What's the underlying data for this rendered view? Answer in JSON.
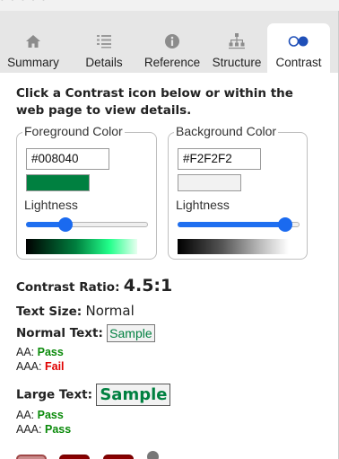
{
  "tabs": [
    {
      "id": "summary",
      "label": "Summary",
      "icon": "home-icon",
      "active": false
    },
    {
      "id": "details",
      "label": "Details",
      "icon": "list-icon",
      "active": false
    },
    {
      "id": "reference",
      "label": "Reference",
      "icon": "info-icon",
      "active": false
    },
    {
      "id": "structure",
      "label": "Structure",
      "icon": "hierarchy-icon",
      "active": false
    },
    {
      "id": "contrast",
      "label": "Contrast",
      "icon": "contrast-icon",
      "active": true
    }
  ],
  "instruction": "Click a Contrast icon below or within the web page to view details.",
  "foreground": {
    "legend": "Foreground Color",
    "value": "#008040",
    "lightness_label": "Lightness",
    "lightness": 0.3
  },
  "background": {
    "legend": "Background Color",
    "value": "#F2F2F2",
    "lightness_label": "Lightness",
    "lightness": 0.93
  },
  "contrast": {
    "ratio_label": "Contrast Ratio:",
    "ratio_value": "4.5:1"
  },
  "text_size": {
    "label": "Text Size:",
    "value": "Normal"
  },
  "normal_text": {
    "label": "Normal Text:",
    "sample": "Sample",
    "aa_label": "AA:",
    "aa_value": "Pass",
    "aaa_label": "AAA:",
    "aaa_value": "Fail"
  },
  "large_text": {
    "label": "Large Text:",
    "sample": "Sample",
    "aa_label": "AA:",
    "aa_value": "Pass",
    "aaa_label": "AAA:",
    "aaa_value": "Pass"
  },
  "colors": {
    "accent": "#1a6af0",
    "pass": "#0a8a0a",
    "fail": "#e00000",
    "tab_bar": "#e6e6e6"
  }
}
